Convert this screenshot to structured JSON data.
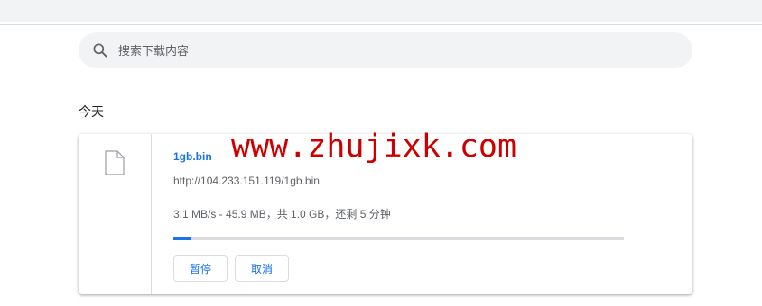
{
  "search": {
    "placeholder": "搜索下载内容"
  },
  "section": {
    "label": "今天"
  },
  "download": {
    "file_name": "1gb.bin",
    "url": "http://104.233.151.119/1gb.bin",
    "status": "3.1 MB/s - 45.9 MB，共 1.0 GB，还剩 5 分钟",
    "progress_fraction": 0.04,
    "pause_label": "暂停",
    "cancel_label": "取消"
  },
  "watermark": {
    "text": "www.zhujixk.com"
  },
  "colors": {
    "accent": "#1a73e8",
    "watermark": "#cc0000"
  },
  "icons": {
    "search": "search-icon",
    "file": "file-icon"
  }
}
